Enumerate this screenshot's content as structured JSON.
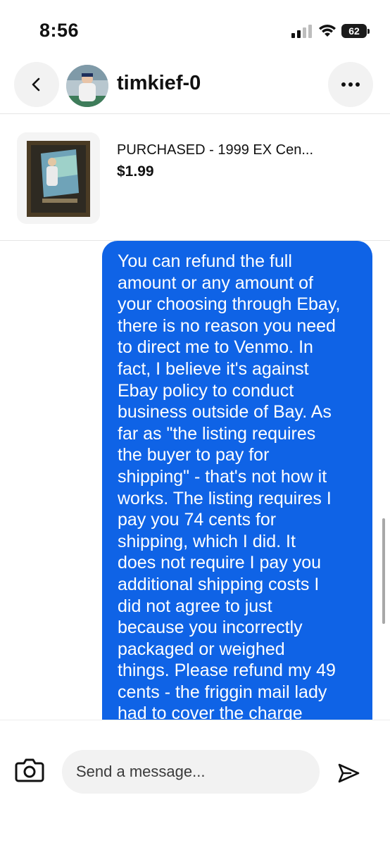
{
  "status_bar": {
    "time": "8:56",
    "battery_level": "62"
  },
  "header": {
    "username": "timkief-0",
    "back_icon": "chevron-left-icon",
    "more_icon": "more-horizontal-icon"
  },
  "listing": {
    "title": "PURCHASED - 1999 EX Cen...",
    "price": "$1.99"
  },
  "message": {
    "lines": [
      "You can refund the full",
      "amount or any amount of",
      "your choosing through Ebay,",
      "there is no reason you need",
      "to direct me to Venmo.  In",
      "fact, I believe it's against",
      "Ebay policy to conduct",
      "business outside of Bay.  As",
      "far as \"the listing requires",
      "the buyer to pay for",
      "shipping\" - that's not how it",
      "works.  The listing requires I",
      "pay you 74 cents for",
      "shipping, which I did.  It",
      "does not require I pay you",
      "additional shipping costs I",
      "did not agree to just",
      "because you incorrectly",
      "packaged or weighed",
      "things.  Please refund my 49",
      "cents - the friggin mail lady",
      "had to cover the charge"
    ]
  },
  "composer": {
    "placeholder": "Send a message...",
    "camera_icon": "camera-icon",
    "send_icon": "send-icon"
  },
  "colors": {
    "bubble": "#0f63e6",
    "button_bg": "#f2f2f2"
  }
}
